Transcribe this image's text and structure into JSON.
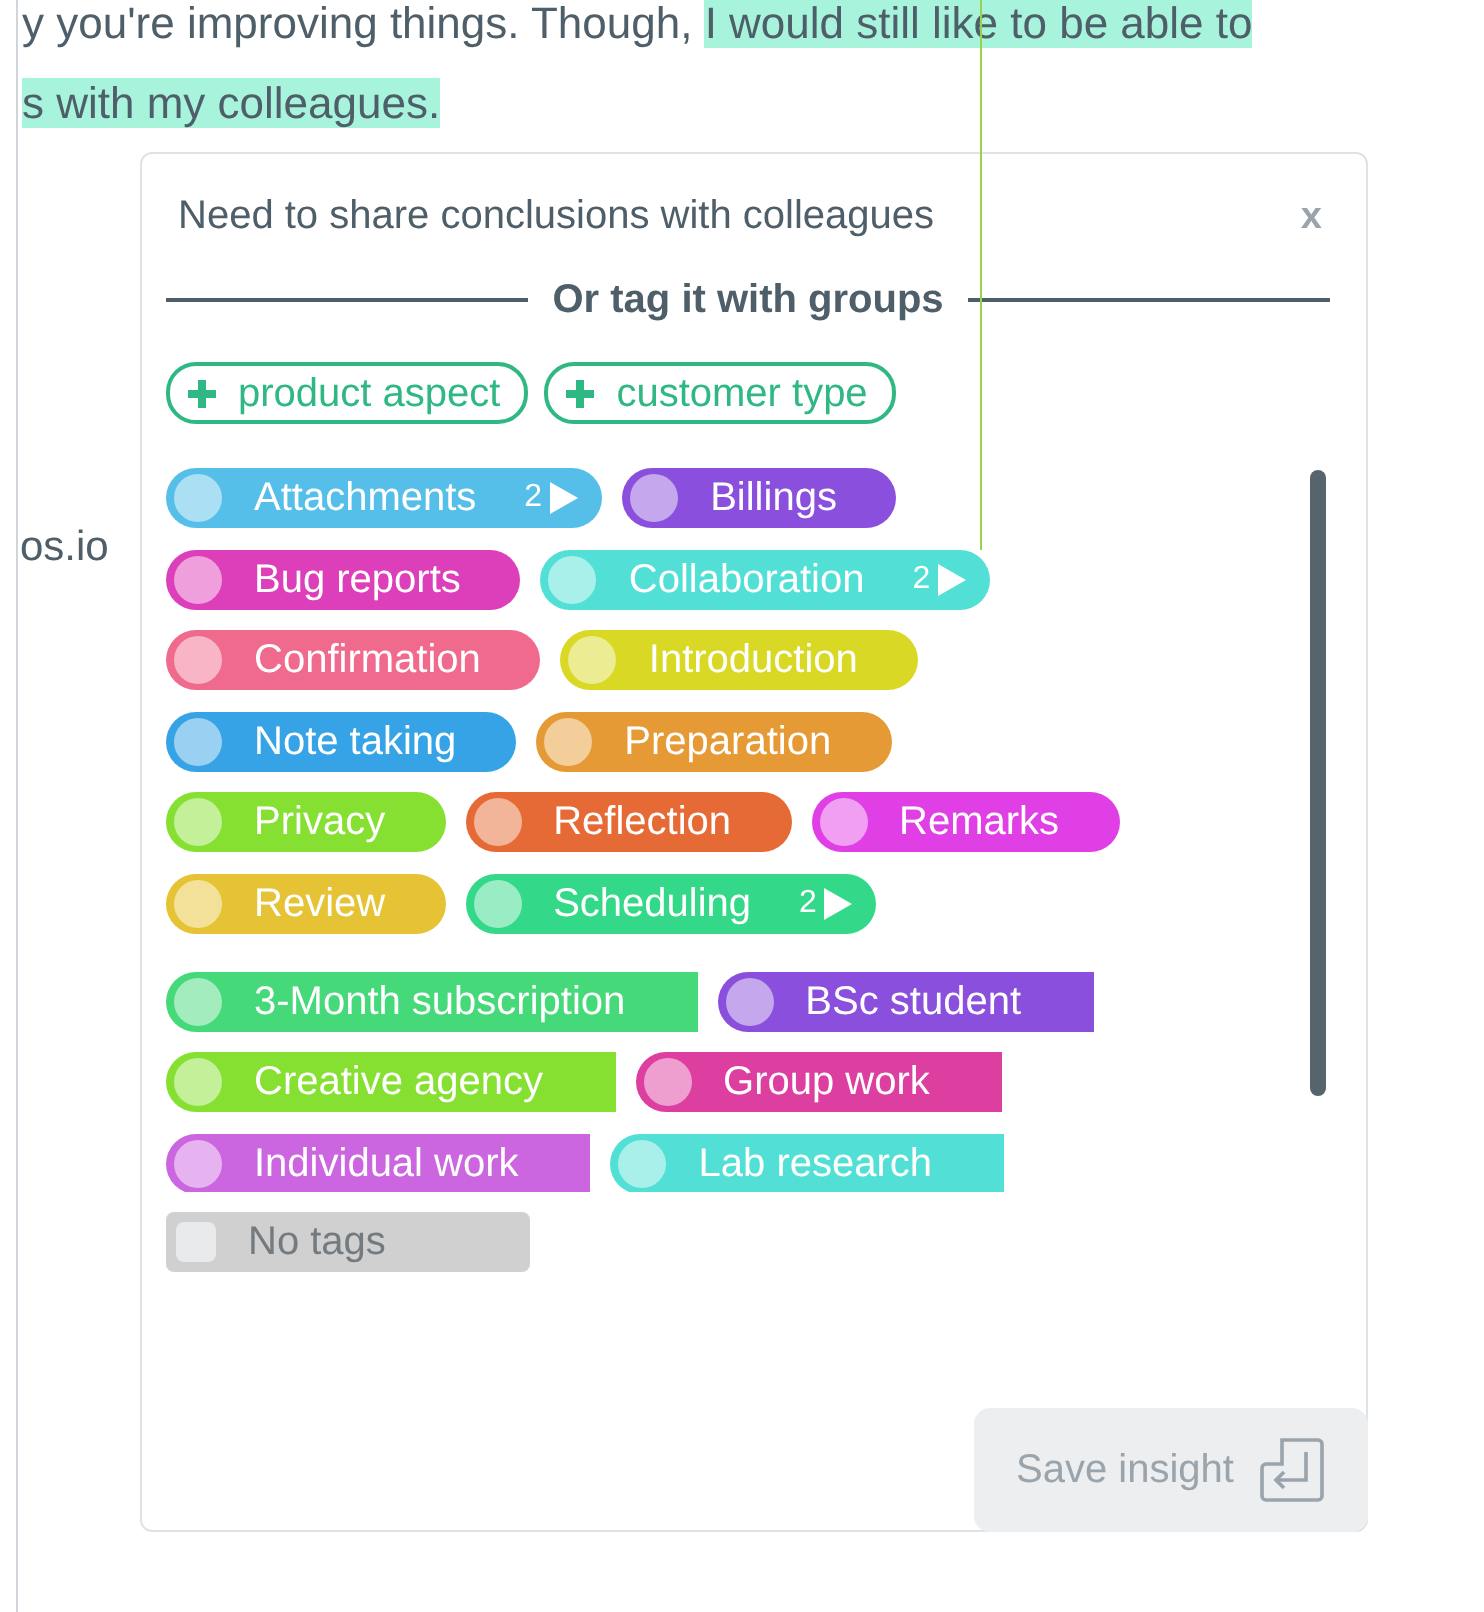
{
  "document": {
    "lines": [
      {
        "plain": "y you're improving things. Though, ",
        "highlighted": "I would still like to be able to"
      },
      {
        "highlighted": "s with my colleagues."
      }
    ],
    "side_text": "os.io"
  },
  "popup": {
    "title": "Need to share conclusions with colleagues",
    "close": "x",
    "divider_label": "Or tag it with groups",
    "add_buttons": [
      "product aspect",
      "customer type"
    ],
    "tag_lists": [
      {
        "kind": "pill",
        "items": [
          {
            "label": "Attachments",
            "color": "#56bfe9",
            "count": "2"
          },
          {
            "label": "Billings",
            "color": "#8a4fdc"
          },
          {
            "label": "Bug reports",
            "color": "#dc3fb9"
          },
          {
            "label": "Collaboration",
            "color": "#52e0d6",
            "count": "2"
          },
          {
            "label": "Confirmation",
            "color": "#ef6a8c"
          },
          {
            "label": "Introduction",
            "color": "#d9d925"
          },
          {
            "label": "Note taking",
            "color": "#35a3e5"
          },
          {
            "label": "Preparation",
            "color": "#e69a35"
          },
          {
            "label": "Privacy",
            "color": "#86e032"
          },
          {
            "label": "Reflection",
            "color": "#e56a35"
          },
          {
            "label": "Remarks",
            "color": "#e03fe5"
          },
          {
            "label": "Review",
            "color": "#e6c235"
          },
          {
            "label": "Scheduling",
            "color": "#33d988",
            "count": "2"
          }
        ]
      },
      {
        "kind": "flag",
        "items": [
          {
            "label": "3-Month subscription",
            "color": "#45d97a"
          },
          {
            "label": "BSc student",
            "color": "#8a4fdc"
          },
          {
            "label": "Creative agency",
            "color": "#86e032"
          },
          {
            "label": "Group work",
            "color": "#dc3fa0"
          },
          {
            "label": "Individual work",
            "color": "#cc66e0"
          },
          {
            "label": "Lab research",
            "color": "#52e0d6"
          }
        ]
      }
    ],
    "no_tags": {
      "label": "No tags",
      "color": "#cfd0cf"
    },
    "save_button": "Save insight"
  }
}
